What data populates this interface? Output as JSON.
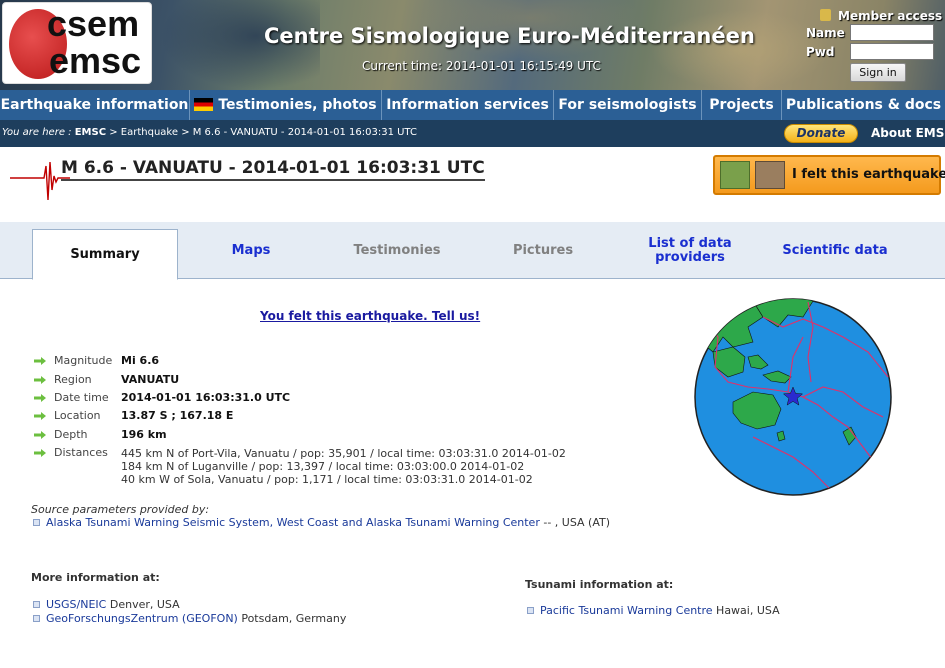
{
  "header": {
    "logo_line1": "csem",
    "logo_line2": "emsc",
    "site_title": "Centre Sismologique Euro-Méditerranéen",
    "current_time": "Current time: 2014-01-01 16:15:49 UTC",
    "member_access": "Member access",
    "name_label": "Name",
    "pwd_label": "Pwd",
    "sign_in": "Sign in"
  },
  "nav": [
    "Earthquake information",
    "Testimonies, photos",
    "Information services",
    "For seismologists",
    "Projects",
    "Publications & docs"
  ],
  "breadcrumb": {
    "prefix": "You are here :",
    "root": "EMSC",
    "path": "> Earthquake > M 6.6 - VANUATU - 2014-01-01 16:03:31 UTC",
    "donate": "Donate",
    "about": "About EMSC"
  },
  "quake": {
    "title": "M 6.6 - VANUATU - 2014-01-01 16:03:31 UTC",
    "felt_button": "I felt this earthquake"
  },
  "tabs": [
    {
      "label": "Summary",
      "state": "active"
    },
    {
      "label": "Maps",
      "state": "link"
    },
    {
      "label": "Testimonies",
      "state": "dim"
    },
    {
      "label": "Pictures",
      "state": "dim"
    },
    {
      "label": "List of data providers",
      "state": "link"
    },
    {
      "label": "Scientific data",
      "state": "link"
    }
  ],
  "tell_us": "You felt this earthquake. Tell us!",
  "details": [
    {
      "key": "Magnitude",
      "value": "Mi 6.6"
    },
    {
      "key": "Region",
      "value": "VANUATU"
    },
    {
      "key": "Date time",
      "value": "2014-01-01 16:03:31.0 UTC"
    },
    {
      "key": "Location",
      "value": "13.87 S ; 167.18 E"
    },
    {
      "key": "Depth",
      "value": "196 km"
    },
    {
      "key": "Distances",
      "value": ""
    }
  ],
  "distances": [
    "445 km N of Port-Vila, Vanuatu / pop: 35,901 / local time: 03:03:31.0 2014-01-02",
    "184 km N of Luganville / pop: 13,397 / local time: 03:03:00.0 2014-01-02",
    "40 km W of Sola, Vanuatu / pop: 1,171 / local time: 03:03:31.0 2014-01-02"
  ],
  "source": {
    "label": "Source parameters provided by:",
    "provider_link": "Alaska Tsunami Warning Seismic System, West Coast and Alaska Tsunami Warning Center",
    "provider_suffix": " -- , USA (AT)"
  },
  "more_info": {
    "title": "More information at:",
    "links": [
      {
        "link": "USGS/NEIC",
        "suffix": " Denver, USA"
      },
      {
        "link": "GeoForschungsZentrum (GEOFON)",
        "suffix": " Potsdam, Germany"
      }
    ]
  },
  "tsunami": {
    "title": "Tsunami information at:",
    "link": "Pacific Tsunami Warning Centre",
    "suffix": "  Hawai, USA"
  },
  "colors": {
    "nav_bg": "#2b5f95",
    "crumb_bg": "#1e3e5d",
    "felt_orange": "#f49a1d",
    "arrow_green": "#6cbf3f"
  }
}
